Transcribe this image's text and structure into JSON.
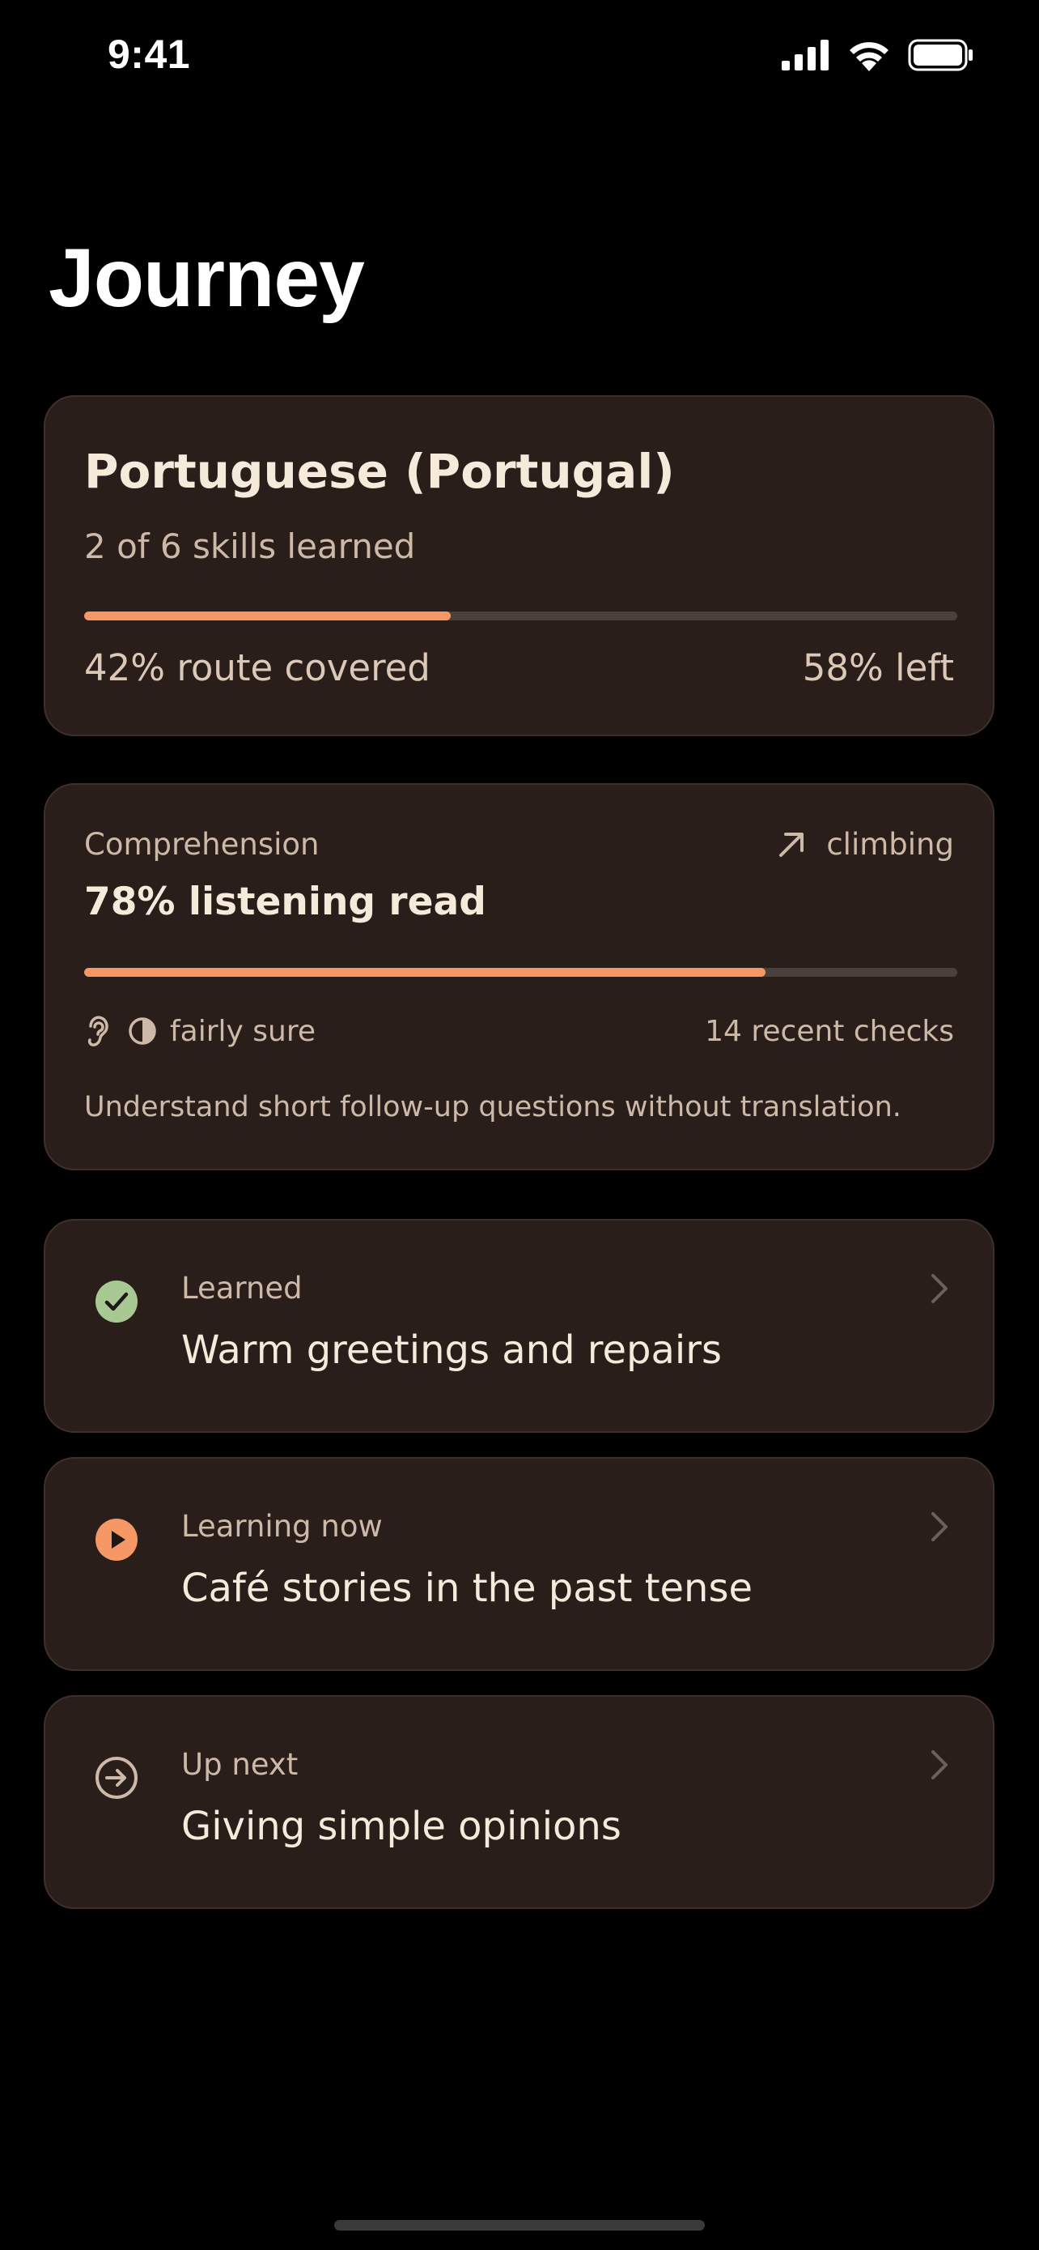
{
  "status_bar": {
    "time": "9:41",
    "icons": [
      "signal-icon",
      "wifi-icon",
      "battery-icon"
    ]
  },
  "page": {
    "title": "Journey"
  },
  "colors": {
    "background": "#000000",
    "card": "#2A1E1B",
    "accent": "#F59866",
    "learned": "#A8C994",
    "text_primary": "#F6EADB",
    "text_secondary": "#CDB9A7"
  },
  "course": {
    "name": "Portuguese (Portugal)",
    "skills_summary": "2 of 6 skills learned",
    "progress": 0.42,
    "covered_label": "42% route covered",
    "left_label": "58% left"
  },
  "comprehension": {
    "label": "Comprehension",
    "trend_icon": "arrow-up-right-icon",
    "trend_label": "climbing",
    "value_label": "78% listening read",
    "progress": 0.78,
    "confidence_icons": [
      "ear-icon",
      "half-circle-icon"
    ],
    "confidence_label": "fairly sure",
    "checks_label": "14 recent checks",
    "description": "Understand short follow-up questions without translation."
  },
  "skills": [
    {
      "status": "Learned",
      "title": "Warm greetings and repairs",
      "icon": "check-circle-icon"
    },
    {
      "status": "Learning now",
      "title": "Café stories in the past tense",
      "icon": "play-circle-icon"
    },
    {
      "status": "Up next",
      "title": "Giving simple opinions",
      "icon": "arrow-right-circle-icon"
    }
  ]
}
